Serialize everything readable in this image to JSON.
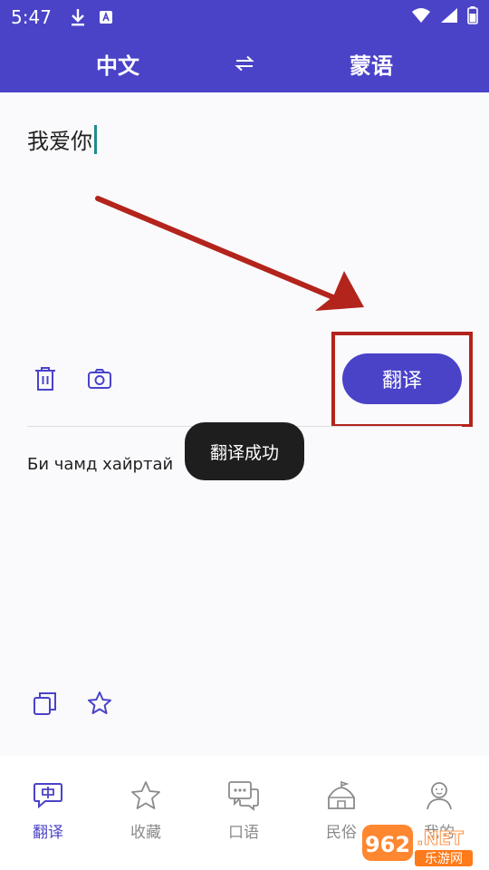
{
  "status_bar": {
    "time": "5:47"
  },
  "header": {
    "source_lang": "中文",
    "target_lang": "蒙语"
  },
  "input": {
    "text": "我爱你"
  },
  "actions": {
    "translate_label": "翻译"
  },
  "output": {
    "text": "Би чамд хайртай"
  },
  "toast": {
    "message": "翻译成功"
  },
  "bottom_nav": {
    "items": [
      {
        "label": "翻译",
        "icon": "translate-icon",
        "active": true
      },
      {
        "label": "收藏",
        "icon": "star-icon",
        "active": false
      },
      {
        "label": "口语",
        "icon": "chat-icon",
        "active": false
      },
      {
        "label": "民俗",
        "icon": "yurt-icon",
        "active": false
      },
      {
        "label": "我的",
        "icon": "profile-icon",
        "active": false
      }
    ]
  },
  "watermark": {
    "number": "962",
    "suffix": ".NET",
    "caption": "乐游网"
  },
  "colors": {
    "primary": "#4a43c8",
    "annotation_red": "#b3241c",
    "toast_bg": "#1e1e1e"
  }
}
